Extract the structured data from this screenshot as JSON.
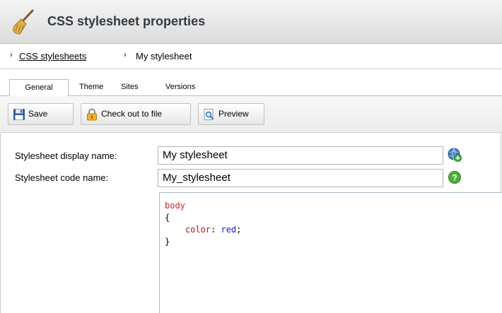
{
  "header": {
    "title": "CSS stylesheet properties",
    "icon": "broom-icon"
  },
  "breadcrumb": {
    "separator": "›",
    "parent_label": "CSS stylesheets",
    "current_label": "My stylesheet"
  },
  "tabs": [
    {
      "label": "General",
      "active": true
    },
    {
      "label": "Theme",
      "active": false
    },
    {
      "label": "Sites",
      "active": false
    },
    {
      "label": "Versions",
      "active": false
    }
  ],
  "toolbar": {
    "save_label": "Save",
    "checkout_label": "Check out to file",
    "preview_label": "Preview"
  },
  "form": {
    "display_name_label": "Stylesheet display name:",
    "display_name_value": "My stylesheet",
    "code_name_label": "Stylesheet code name:",
    "code_name_value": "My_stylesheet"
  },
  "code_editor": {
    "line1": "body",
    "line2": "{",
    "line3_indent": "    ",
    "line3_property": "color",
    "line3_colon": ": ",
    "line3_value": "red",
    "line3_end": ";",
    "line4": "}"
  },
  "colors": {
    "selector": "#c62828",
    "property": "#b01515",
    "value": "#1a1acc"
  }
}
